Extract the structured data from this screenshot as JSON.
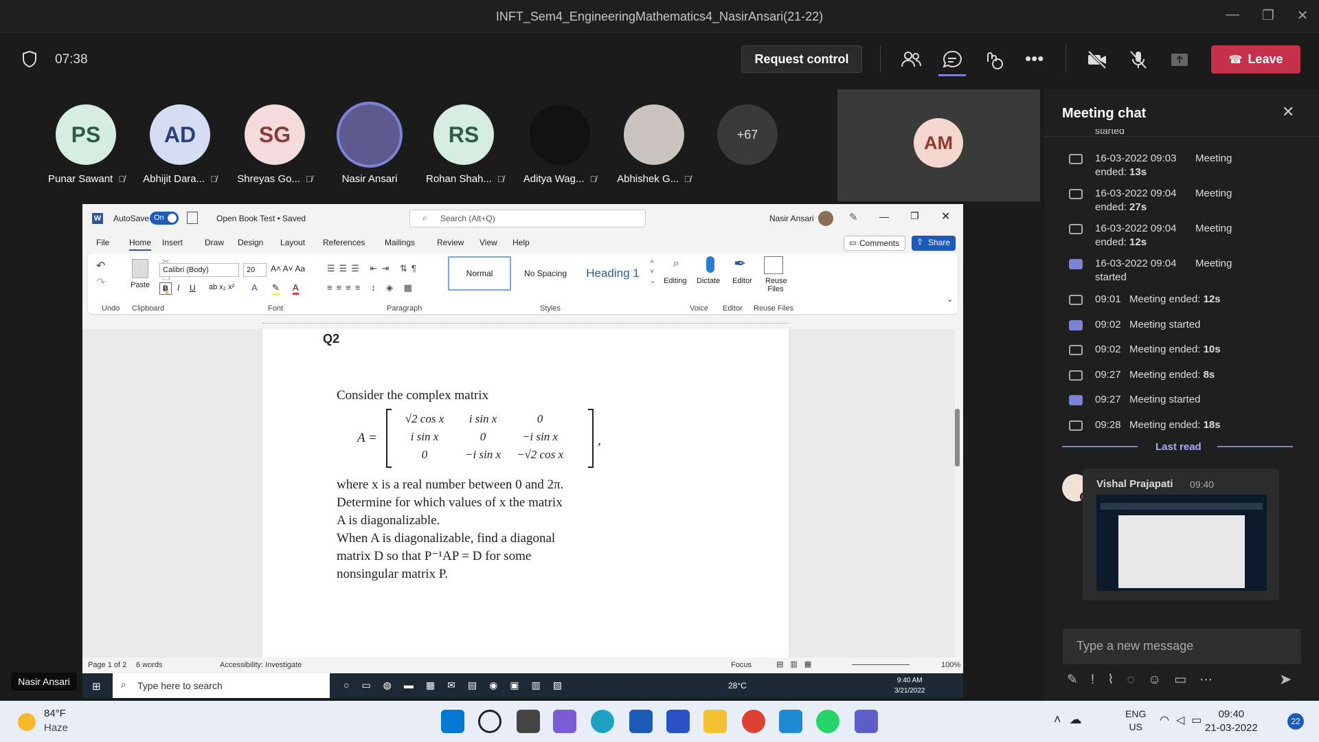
{
  "window": {
    "title": "INFT_Sem4_EngineeringMathematics4_NasirAnsari(21-22)"
  },
  "meeting": {
    "timer": "07:38",
    "request_control": "Request control",
    "leave": "Leave"
  },
  "participants": [
    {
      "initials": "PS",
      "name": "Punar Sawant",
      "bg": "#d6ede2",
      "fg": "#2d5d46"
    },
    {
      "initials": "AD",
      "name": "Abhijit Dara...",
      "bg": "#d5ddf2",
      "fg": "#2f3f78"
    },
    {
      "initials": "SG",
      "name": "Shreyas Go...",
      "bg": "#f5dcdc",
      "fg": "#8a3b3b"
    },
    {
      "initials": "",
      "name": "Nasir Ansari",
      "bg": "#5e5a8f",
      "fg": "#fff"
    },
    {
      "initials": "RS",
      "name": "Rohan Shah...",
      "bg": "#d6ede2",
      "fg": "#2d5d46"
    },
    {
      "initials": "",
      "name": "Aditya Wag...",
      "bg": "#111",
      "fg": "#fff"
    },
    {
      "initials": "",
      "name": "Abhishek G...",
      "bg": "#c9c4bd",
      "fg": "#fff"
    },
    {
      "initials": "+67",
      "name": "",
      "bg": "#3a3a3a",
      "fg": "#ddd"
    }
  ],
  "self_tile": {
    "initials": "AM"
  },
  "self_label": "Nasir Ansari",
  "word": {
    "autosave": "AutoSave",
    "autosave_state": "On",
    "doc_name": "Open Book Test • Saved",
    "search_placeholder": "Search (Alt+Q)",
    "user": "Nasir Ansari",
    "menu": [
      "File",
      "Home",
      "Insert",
      "Draw",
      "Design",
      "Layout",
      "References",
      "Mailings",
      "Review",
      "View",
      "Help"
    ],
    "comments": "Comments",
    "share": "Share",
    "font_name": "Calibri (Body)",
    "font_size": "20",
    "styles": [
      "Normal",
      "No Spacing",
      "Heading 1"
    ],
    "groups": [
      "Undo",
      "Clipboard",
      "Font",
      "Paragraph",
      "Styles",
      "Voice",
      "Editor",
      "Reuse Files"
    ],
    "tools": {
      "paste": "Paste",
      "editing": "Editing",
      "dictate": "Dictate",
      "editor": "Editor",
      "reuse": "Reuse Files"
    },
    "doc": {
      "heading": "Q2",
      "para1": "Consider the complex matrix",
      "matrix_label": "A =",
      "matrix": [
        [
          "√2 cos x",
          "i sin x",
          "0"
        ],
        [
          "i sin x",
          "0",
          "−i sin x"
        ],
        [
          "0",
          "−i sin x",
          "−√2 cos x"
        ]
      ],
      "lines": [
        "where x is a real number between 0 and 2π.",
        "Determine for which values of x the matrix",
        "A is diagonalizable.",
        "When A is diagonalizable, find a diagonal",
        "matrix D so that P⁻¹AP = D for some",
        "nonsingular matrix P."
      ]
    },
    "status": {
      "page": "Page 1 of 2",
      "words": "6 words",
      "accessibility": "Accessibility: Investigate",
      "focus": "Focus",
      "zoom": "100%"
    }
  },
  "inner_taskbar": {
    "search": "Type here to search",
    "weather": "28°C",
    "time": "9:40 AM",
    "date": "3/21/2022"
  },
  "chat": {
    "title": "Meeting chat",
    "cut_text": "started",
    "events": [
      {
        "time": "16-03-2022 09:03",
        "text": "Meeting",
        "text2": "ended: ",
        "bold": "13s",
        "filled": false
      },
      {
        "time": "16-03-2022 09:04",
        "text": "Meeting",
        "text2": "ended: ",
        "bold": "27s",
        "filled": false
      },
      {
        "time": "16-03-2022 09:04",
        "text": "Meeting",
        "text2": "ended: ",
        "bold": "12s",
        "filled": false
      },
      {
        "time": "16-03-2022 09:04",
        "text": "Meeting",
        "text2": "started",
        "bold": "",
        "filled": true
      }
    ],
    "short_events": [
      {
        "time": "09:01",
        "text": "Meeting ended: ",
        "bold": "12s",
        "filled": false
      },
      {
        "time": "09:02",
        "text": "Meeting started",
        "bold": "",
        "filled": true
      },
      {
        "time": "09:02",
        "text": "Meeting ended: ",
        "bold": "10s",
        "filled": false
      },
      {
        "time": "09:27",
        "text": "Meeting ended: ",
        "bold": "8s",
        "filled": false
      },
      {
        "time": "09:27",
        "text": "Meeting started",
        "bold": "",
        "filled": true
      },
      {
        "time": "09:28",
        "text": "Meeting ended: ",
        "bold": "18s",
        "filled": false
      }
    ],
    "last_read": "Last read",
    "message": {
      "author": "Vishal Prajapati",
      "time": "09:40"
    },
    "input_placeholder": "Type a new message"
  },
  "os": {
    "temp": "84°F",
    "weather": "Haze",
    "lang1": "ENG",
    "lang2": "US",
    "time": "09:40",
    "date": "21-03-2022",
    "notif": "22"
  }
}
